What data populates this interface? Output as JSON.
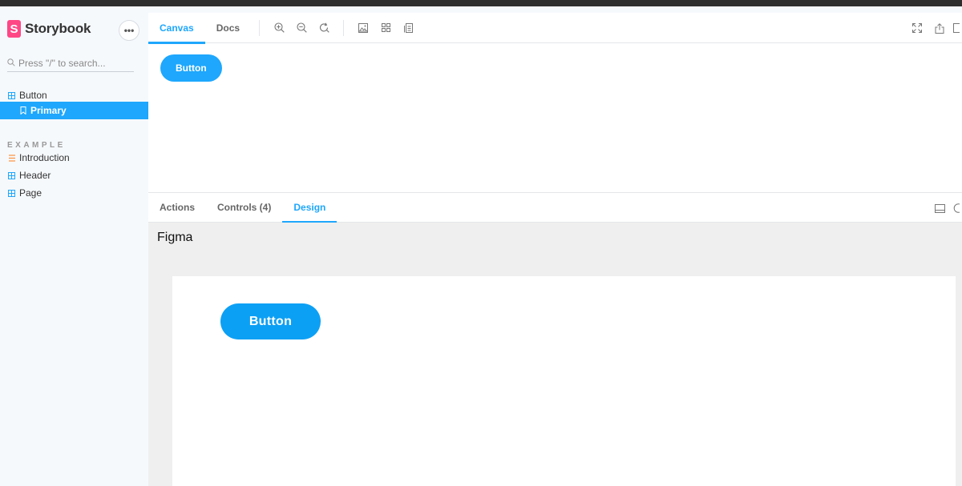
{
  "sidebar": {
    "brand": "Storybook",
    "brand_mark": "S",
    "more": "•••",
    "search_placeholder": "Press \"/\" to search...",
    "groups": [
      {
        "label": "Button",
        "icon": "component-icon"
      },
      {
        "label": "Primary",
        "icon": "bookmark-icon",
        "selected": true
      }
    ],
    "section_label": "EXAMPLE",
    "items": [
      {
        "label": "Introduction",
        "icon": "document-icon"
      },
      {
        "label": "Header",
        "icon": "component-icon"
      },
      {
        "label": "Page",
        "icon": "component-icon"
      }
    ]
  },
  "toolbar": {
    "tabs": [
      {
        "label": "Canvas",
        "active": true
      },
      {
        "label": "Docs",
        "active": false
      }
    ],
    "icons": [
      "zoom-in-icon",
      "zoom-out-icon",
      "zoom-reset-icon",
      "background-icon",
      "grid-icon",
      "outline-icon"
    ],
    "right_icons": [
      "fullscreen-icon",
      "share-icon",
      "copy-icon"
    ]
  },
  "canvas": {
    "button_label": "Button"
  },
  "addons": {
    "tabs": [
      {
        "label": "Actions",
        "active": false
      },
      {
        "label": "Controls (4)",
        "active": false
      },
      {
        "label": "Design",
        "active": true
      }
    ],
    "right_icons": [
      "panel-layout-icon",
      "close-panel-icon"
    ]
  },
  "panel": {
    "title": "Figma",
    "button_label": "Button"
  },
  "colors": {
    "accent": "#1ea7fd",
    "brand": "#ff4785"
  }
}
